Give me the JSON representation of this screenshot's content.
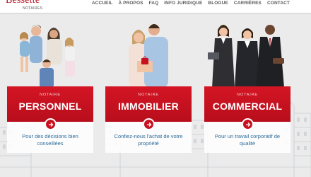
{
  "header": {
    "logo_name": "Bessette",
    "logo_sub": "NOTAIRES",
    "nav": [
      "ACCUEIL",
      "À PROPOS",
      "FAQ",
      "INFO JURIDIQUE",
      "BLOGUE",
      "CARRIÈRES",
      "CONTACT"
    ]
  },
  "cards": [
    {
      "kicker": "NOTAIRE",
      "title": "PERSONNEL",
      "text": "Pour des décisions bien conseillées",
      "icon": "arrow-right-icon"
    },
    {
      "kicker": "NOTAIRE",
      "title": "IMMOBILIER",
      "text": "Confiez-nous l'achat de votre propriété",
      "icon": "arrow-right-icon"
    },
    {
      "kicker": "NOTAIRE",
      "title": "COMMERCIAL",
      "text": "Pour un travail corporatif de qualité",
      "icon": "arrow-right-icon"
    }
  ],
  "colors": {
    "brand_red": "#c8101f",
    "link_blue": "#2b6a9a",
    "background": "#ebebeb"
  }
}
